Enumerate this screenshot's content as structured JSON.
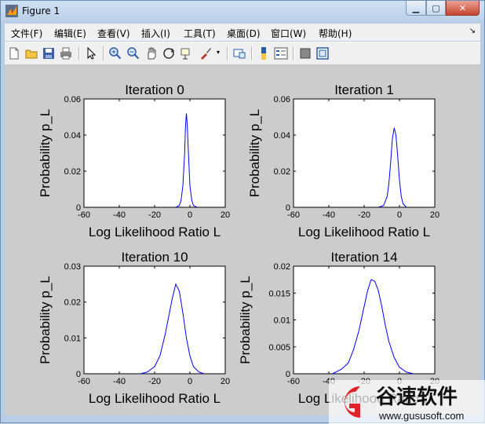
{
  "window": {
    "title": "Figure 1"
  },
  "menu": [
    "文件(F)",
    "编辑(E)",
    "查看(V)",
    "插入(I)",
    "工具(T)",
    "桌面(D)",
    "窗口(W)",
    "帮助(H)"
  ],
  "watermark": {
    "brand": "谷速软件",
    "url": "www.gususoft.com"
  },
  "chart_data": [
    {
      "type": "line",
      "title": "Iteration 0",
      "xlabel": "Log Likelihood Ratio L",
      "ylabel": "Probability p_L",
      "xlim": [
        -60,
        20
      ],
      "ylim": [
        0,
        0.06
      ],
      "xticks": [
        "-60",
        "-40",
        "-20",
        "0",
        "20"
      ],
      "yticks": [
        "0",
        "0.02",
        "0.04",
        "0.06"
      ],
      "series": [
        {
          "color": "#0000ff",
          "x": [
            -8,
            -6,
            -5,
            -4,
            -3,
            -2.5,
            -2,
            -1.5,
            -1,
            0,
            1,
            2,
            4
          ],
          "y": [
            0,
            0.001,
            0.004,
            0.012,
            0.03,
            0.045,
            0.052,
            0.046,
            0.033,
            0.012,
            0.004,
            0.001,
            0
          ]
        }
      ]
    },
    {
      "type": "line",
      "title": "Iteration 1",
      "xlabel": "Log Likelihood Ratio L",
      "ylabel": "Probability p_L",
      "xlim": [
        -60,
        20
      ],
      "ylim": [
        0,
        0.06
      ],
      "xticks": [
        "-60",
        "-40",
        "-20",
        "0",
        "20"
      ],
      "yticks": [
        "0",
        "0.02",
        "0.04",
        "0.06"
      ],
      "series": [
        {
          "color": "#0000ff",
          "x": [
            -12,
            -9,
            -7,
            -6,
            -5,
            -4,
            -3,
            -2,
            -1,
            0,
            1,
            2,
            4
          ],
          "y": [
            0,
            0.001,
            0.006,
            0.013,
            0.025,
            0.038,
            0.044,
            0.04,
            0.028,
            0.015,
            0.006,
            0.002,
            0
          ]
        }
      ]
    },
    {
      "type": "line",
      "title": "Iteration 10",
      "xlabel": "Log Likelihood Ratio L",
      "ylabel": "Probability p_L",
      "xlim": [
        -60,
        20
      ],
      "ylim": [
        0,
        0.03
      ],
      "xticks": [
        "-60",
        "-40",
        "-20",
        "0",
        "20"
      ],
      "yticks": [
        "0",
        "0.01",
        "0.02",
        "0.03"
      ],
      "series": [
        {
          "color": "#0000ff",
          "x": [
            -28,
            -24,
            -20,
            -17,
            -14,
            -12,
            -10,
            -8,
            -6,
            -4,
            -2,
            0,
            2,
            5,
            8
          ],
          "y": [
            0,
            0.0005,
            0.002,
            0.005,
            0.011,
            0.016,
            0.021,
            0.025,
            0.023,
            0.017,
            0.01,
            0.005,
            0.002,
            0.0005,
            0
          ]
        }
      ]
    },
    {
      "type": "line",
      "title": "Iteration 14",
      "xlabel": "Log Likelihood Ratio L",
      "ylabel": "Probability p_L",
      "xlim": [
        -60,
        20
      ],
      "ylim": [
        0,
        0.02
      ],
      "xticks": [
        "-60",
        "-40",
        "-20",
        "0",
        "20"
      ],
      "yticks": [
        "0",
        "0.005",
        "0.01",
        "0.015",
        "0.02"
      ],
      "series": [
        {
          "color": "#0000ff",
          "x": [
            -38,
            -33,
            -29,
            -26,
            -23,
            -20,
            -18,
            -16,
            -14,
            -12,
            -10,
            -8,
            -6,
            -3,
            0,
            4,
            8
          ],
          "y": [
            0,
            0.0008,
            0.002,
            0.0045,
            0.008,
            0.0125,
            0.0155,
            0.0175,
            0.0172,
            0.0155,
            0.0125,
            0.009,
            0.006,
            0.003,
            0.0012,
            0.0003,
            0
          ]
        }
      ]
    }
  ]
}
